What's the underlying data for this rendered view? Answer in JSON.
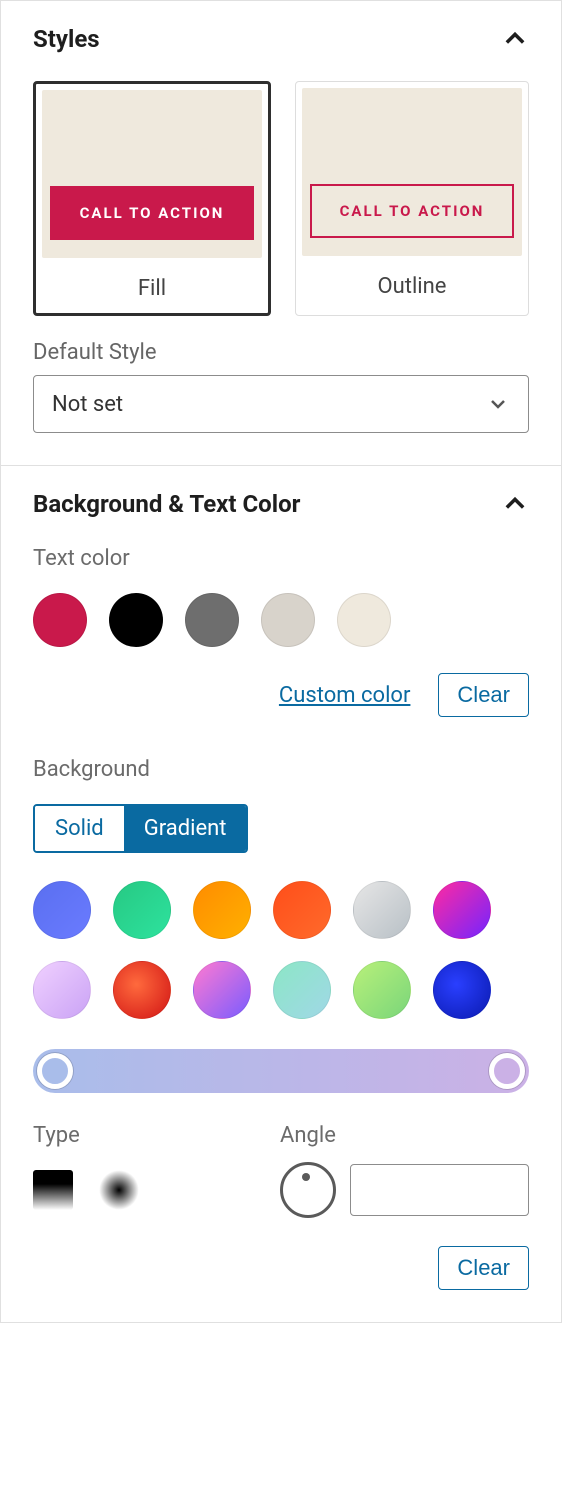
{
  "styles": {
    "title": "Styles",
    "cta_label": "CALL TO ACTION",
    "fill_label": "Fill",
    "outline_label": "Outline",
    "default_style_label": "Default Style",
    "default_style_value": "Not set"
  },
  "bgtext": {
    "title": "Background & Text Color",
    "text_color_label": "Text color",
    "text_swatches": [
      "#c9194b",
      "#000000",
      "#6e6e6e",
      "#d8d3cb",
      "#efe9dd"
    ],
    "custom_color_link": "Custom color",
    "clear_button": "Clear",
    "background_label": "Background",
    "tab_solid": "Solid",
    "tab_gradient": "Gradient",
    "gradient_swatches": [
      "linear-gradient(135deg,#5a6ff0,#6a7bff)",
      "linear-gradient(135deg,#27c983,#2de29e)",
      "linear-gradient(135deg,#ff8c00,#ffb000)",
      "linear-gradient(135deg,#ff4e1a,#ff6a2b)",
      "linear-gradient(135deg,#e6e6e6,#b8c0c6)",
      "linear-gradient(135deg,#ff2aa1,#7424ff)",
      "linear-gradient(135deg,#f0d0ff,#caa3f5)",
      "radial-gradient(circle at 40% 40%,#ff6a3d,#d11414)",
      "linear-gradient(135deg,#ff7ad1,#7a5cff)",
      "linear-gradient(135deg,#8ce6c6,#a0d8e6)",
      "linear-gradient(135deg,#b8f07a,#7ad67a)",
      "radial-gradient(circle at 40% 40%,#2a3fff,#0a1ab0)"
    ],
    "gradient_bar": {
      "start": "#a9bdea",
      "end": "#cbb1e6"
    },
    "type_label": "Type",
    "angle_label": "Angle",
    "angle_value": ""
  }
}
